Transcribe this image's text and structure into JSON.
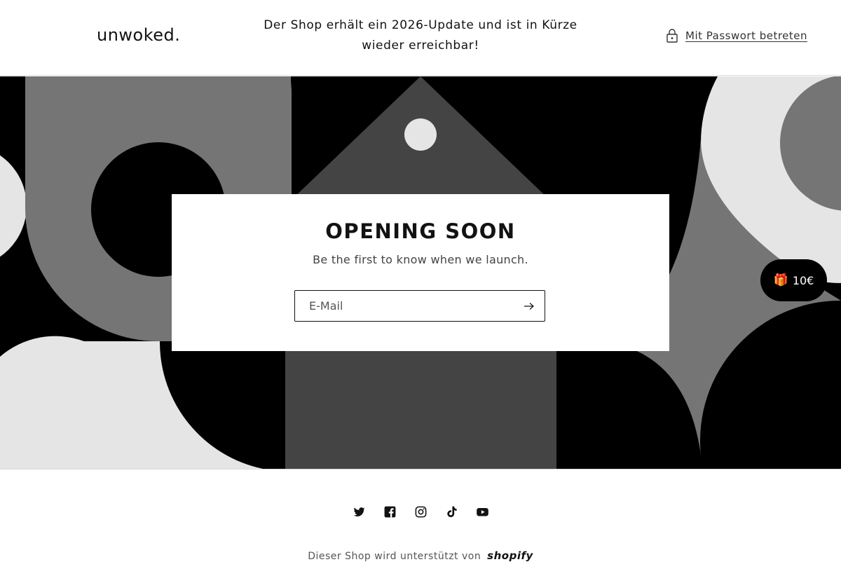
{
  "header": {
    "logo": "unwoked.",
    "announcement_line1": "Der Shop erhält ein 2026-Update und ist in Kürze",
    "announcement_line2": "wieder erreichbar!",
    "password_label": "Mit Passwort betreten",
    "password_icon": "lock-icon"
  },
  "hero": {
    "title": "OPENING SOON",
    "subtitle": "Be the first to know when we launch.",
    "email_placeholder": "E-Mail",
    "email_value": "",
    "submit_icon": "arrow-right-icon"
  },
  "gift_badge": {
    "icon": "gift-icon",
    "label": "10€"
  },
  "footer": {
    "socials": [
      "twitter-icon",
      "facebook-icon",
      "instagram-icon",
      "tiktok-icon",
      "youtube-icon"
    ],
    "powered_text": "Dieser Shop wird unterstützt von",
    "powered_brand": "shopify"
  },
  "colors": {
    "black": "#000000",
    "dark_gray": "#444444",
    "mid_gray": "#757575",
    "light_gray": "#e5e5e5",
    "text": "#121212"
  }
}
